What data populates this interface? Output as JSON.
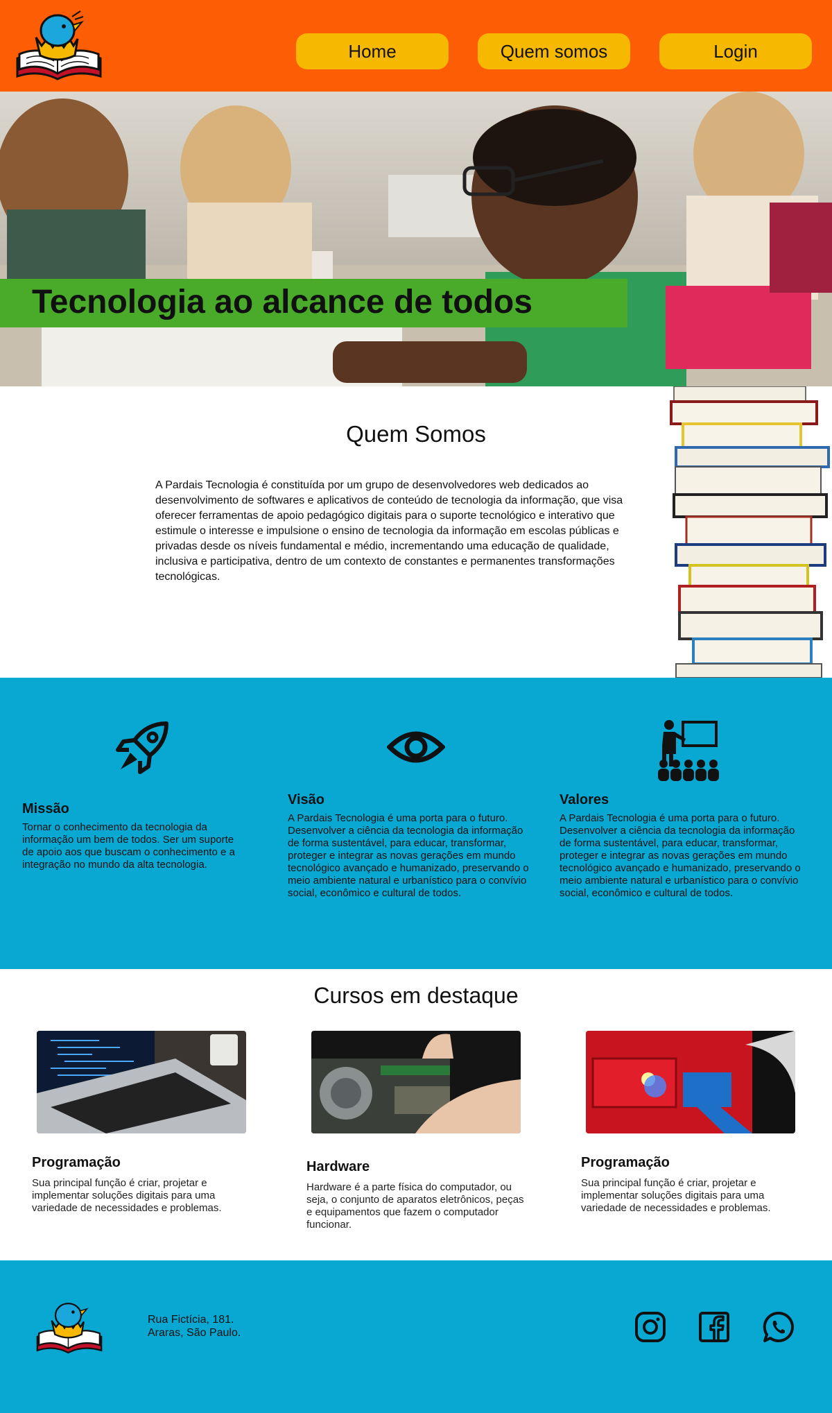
{
  "nav": {
    "home": "Home",
    "about": "Quem somos",
    "login": "Login"
  },
  "hero": {
    "title": "Tecnologia ao alcance de todos"
  },
  "about": {
    "title": "Quem Somos",
    "text": "A Pardais Tecnologia é constituída por um grupo de desenvolvedores web dedicados ao desenvolvimento de softwares e aplicativos de conteúdo de tecnologia da informação, que visa oferecer ferramentas de apoio pedagógico digitais para o suporte tecnológico e interativo que estimule o interesse e impulsione o ensino de tecnologia da informação em escolas públicas e privadas desde os níveis fundamental e médio, incrementando uma educação de qualidade, inclusiva e participativa, dentro de um contexto de constantes e permanentes transformações tecnológicas."
  },
  "mvv": [
    {
      "title": "Missão",
      "text": "Tornar o conhecimento da tecnologia da informação um bem de todos. Ser um suporte de apoio aos que buscam o conhecimento e a integração no mundo da alta tecnologia.",
      "icon": "rocket-icon"
    },
    {
      "title": "Visão",
      "text": "A Pardais Tecnologia é uma porta para o futuro. Desenvolver a ciência da tecnologia da informação de forma sustentável, para educar, transformar, proteger e integrar as novas gerações em mundo tecnológico avançado e humanizado, preservando o meio ambiente natural e urbanístico para o convívio social, econômico e cultural de todos.",
      "icon": "eye-icon"
    },
    {
      "title": "Valores",
      "text": "A Pardais Tecnologia é uma porta para o futuro. Desenvolver a ciência da tecnologia da informação de forma sustentável, para educar, transformar, proteger e integrar as novas gerações em mundo tecnológico avançado e humanizado, preservando o meio ambiente natural e urbanístico para o convívio social, econômico e cultural de todos.",
      "icon": "teacher-class-icon"
    }
  ],
  "courses": {
    "title": "Cursos em destaque",
    "items": [
      {
        "title": "Programação",
        "text": "Sua principal função é criar, projetar e implementar soluções digitais para uma variedade de necessidades e problemas."
      },
      {
        "title": "Hardware",
        "text": "Hardware é a parte física do computador, ou seja, o conjunto de aparatos eletrônicos, peças e equipamentos que fazem o computador funcionar."
      },
      {
        "title": "Programação",
        "text": "Sua principal função é criar, projetar e implementar soluções digitais para uma variedade de necessidades e problemas."
      }
    ]
  },
  "footer": {
    "address_line1": "Rua Fictícia, 181.",
    "address_line2": "Araras, São Paulo.",
    "social": [
      "instagram-icon",
      "facebook-icon",
      "whatsapp-icon"
    ]
  },
  "colors": {
    "header": "#fd5d05",
    "nav_button": "#f6b800",
    "hero_banner": "#4aaa2a",
    "section_blue": "#08a8d3"
  }
}
